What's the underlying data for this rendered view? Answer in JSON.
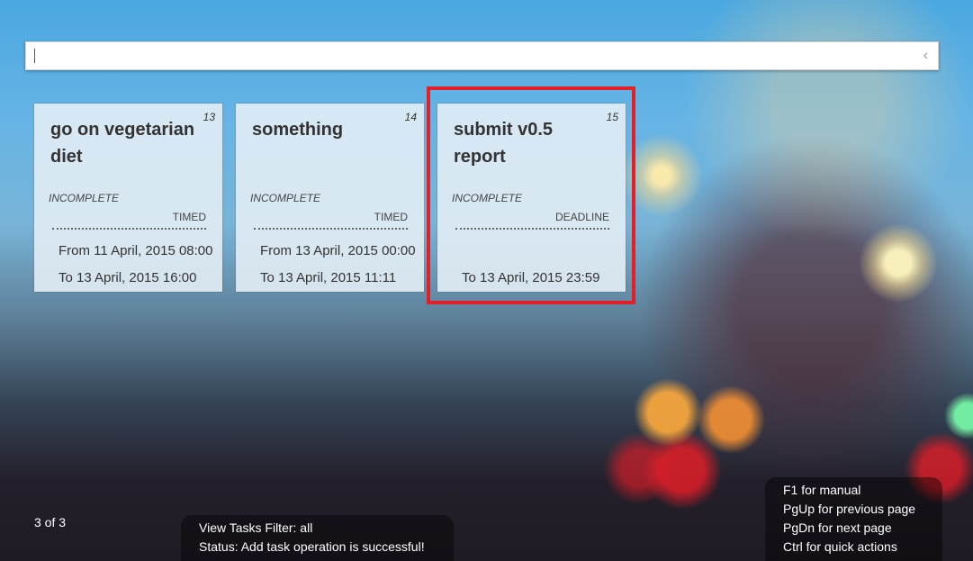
{
  "search": {
    "value": "",
    "placeholder": ""
  },
  "tasks": [
    {
      "number": "13",
      "title": "go on vegetarian diet",
      "status": "INCOMPLETE",
      "type": "TIMED",
      "from": "From 11 April, 2015 08:00",
      "to": "To 13 April, 2015 16:00"
    },
    {
      "number": "14",
      "title": "something",
      "status": "INCOMPLETE",
      "type": "TIMED",
      "from": "From 13 April, 2015 00:00",
      "to": "To 13 April, 2015 11:11"
    },
    {
      "number": "15",
      "title": "submit v0.5 report",
      "status": "INCOMPLETE",
      "type": "DEADLINE",
      "from": "",
      "to": "To 13 April, 2015 23:59"
    }
  ],
  "pagination": {
    "label": "3 of 3"
  },
  "status_panel": {
    "filter": "View Tasks Filter: all",
    "message": "Status: Add task operation is successful!"
  },
  "help_panel": {
    "lines": [
      "F1 for manual",
      "PgUp for previous page",
      "PgDn for next page",
      "Ctrl for quick actions"
    ]
  },
  "colors": {
    "selection": "#e32028",
    "card_background": "#e6eff6"
  },
  "icons": {
    "search_collapse": "chevron-left-icon"
  }
}
